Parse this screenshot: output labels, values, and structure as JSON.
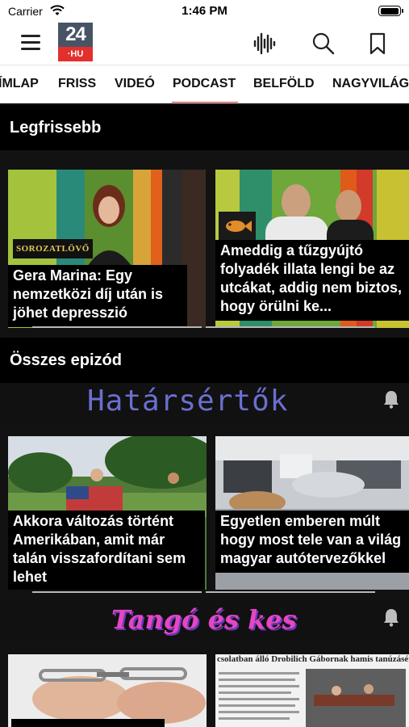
{
  "status": {
    "carrier": "Carrier",
    "time": "1:46 PM"
  },
  "logo": {
    "top": "24",
    "bottom": "·HU"
  },
  "icons": {
    "menu": "hamburger-icon",
    "audio": "waveform-icon",
    "search": "search-icon",
    "bookmark": "bookmark-icon",
    "notify": "bell-icon"
  },
  "nav": {
    "tabs": [
      "ÍMLAP",
      "FRISS",
      "VIDEÓ",
      "PODCAST",
      "BELFÖLD",
      "NAGYVILÁG"
    ],
    "active": "PODCAST"
  },
  "latest": {
    "title": "Legfrissebb",
    "items": [
      {
        "badge": "SOROZATLÖVŐ",
        "title": "Gera Marina: Egy nemzetközi díj után is jöhet depresszió"
      },
      {
        "badge": "fish",
        "title": "Ameddig a tűzgyújtó folyadék illata lengi be az utcákat, addig nem biztos, hogy örülni ke..."
      }
    ]
  },
  "all": {
    "title": "Összes epizód",
    "shows": [
      {
        "name": "Határsértők",
        "items": [
          {
            "title": "Akkora változás történt Amerikában, amit már talán visszafordítani sem lehet"
          },
          {
            "title": "Egyetlen emberen múlt hogy most tele van a világ magyar autótervezőkkel"
          }
        ]
      },
      {
        "name": "Tangó és kes",
        "items": [
          {
            "title": ""
          },
          {
            "title": "csolatban álló Drobilich Gábornak hamis tanúzásért k"
          }
        ]
      }
    ]
  },
  "colors": {
    "accent": "#e2302d",
    "logo_bg": "#475465",
    "dark": "#121212"
  }
}
